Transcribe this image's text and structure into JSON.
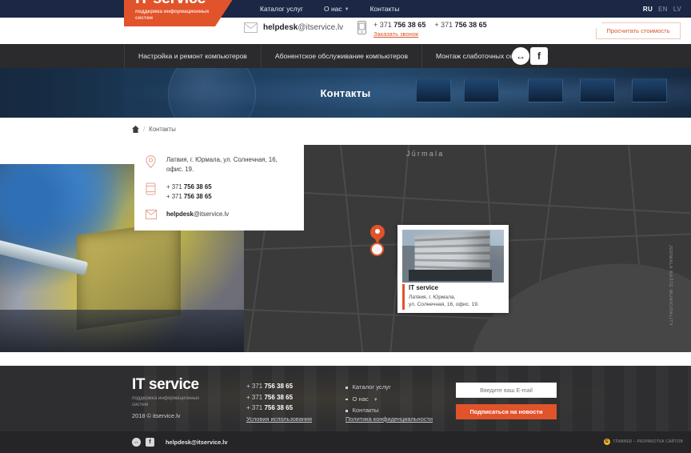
{
  "topbar": {
    "nav": [
      {
        "label": "Каталог услуг",
        "has_caret": false
      },
      {
        "label": "О нас",
        "has_caret": true
      },
      {
        "label": "Контакты",
        "has_caret": false
      }
    ],
    "languages": [
      {
        "code": "RU",
        "active": true
      },
      {
        "code": "EN",
        "active": false
      },
      {
        "code": "LV",
        "active": false
      }
    ]
  },
  "header": {
    "logo": {
      "main": "IT service",
      "sub": "поддержка информационных систем"
    },
    "email": {
      "user": "helpdesk",
      "domain": "@itservice.lv",
      "icon": "envelope-icon"
    },
    "phones": [
      "+ 371 756 38 65",
      "+ 371 756 38 65"
    ],
    "phone_prefix": "+ 371 ",
    "phone_number": "756 38 65",
    "callback_label": "Заказать звонок",
    "calc_button": "Просчитать стоимость"
  },
  "subnav": {
    "items": [
      "Настройка и ремонт компьютеров",
      "Абонентское обслуживание компьютеров",
      "Монтаж слаботочных сетей"
    ],
    "social": [
      {
        "name": "odnoklassniki-icon",
        "glyph": "↔"
      },
      {
        "name": "facebook-icon",
        "glyph": "f"
      }
    ]
  },
  "hero": {
    "title": "Контакты"
  },
  "breadcrumb": {
    "home_icon": "home-icon",
    "separator": "/",
    "current": "Контакты"
  },
  "contact_card": {
    "address_icon": "map-pin-icon",
    "address": "Латвия, г. Юрмала, ул. Солнечная, 16, офис. 19.",
    "phone_icon": "phone-icon",
    "phones": [
      {
        "prefix": "+ 371 ",
        "number": "756 38 65"
      },
      {
        "prefix": "+ 371 ",
        "number": "756 38 65"
      }
    ],
    "email_icon": "envelope-icon",
    "email_user": "helpdesk",
    "email_domain": "@itservice.lv"
  },
  "map": {
    "city_label": "Jūrmala",
    "side_label": "JŪRMALA BAŠTE MUNICIPALITY",
    "marker": "map-marker-icon",
    "popup": {
      "title": "IT service",
      "address_line1": "Латвия, г. Юрмала,",
      "address_line2": "ул. Солнечная, 16, офис. 19."
    }
  },
  "footer": {
    "logo": {
      "main": "IT service",
      "sub": "поддержка информационных систем"
    },
    "copyright": "2018 © itservice.lv",
    "phones": [
      {
        "prefix": "+ 371 ",
        "number": "756 38 65"
      },
      {
        "prefix": "+ 371 ",
        "number": "756 38 65"
      },
      {
        "prefix": "+ 371 ",
        "number": "756 38 65"
      }
    ],
    "terms_link": "Условия использования",
    "menu": [
      {
        "label": "Каталог услуг",
        "has_caret": false
      },
      {
        "label": "О нас",
        "has_caret": true
      },
      {
        "label": "Контакты",
        "has_caret": false
      }
    ],
    "privacy_link": "Политика конфиденциальности",
    "subscribe": {
      "placeholder": "Введите ваш E-mail",
      "value": "",
      "button_label": "Подписаться на новости"
    },
    "bottom": {
      "social": [
        {
          "name": "odnoklassniki-icon",
          "glyph": "↔"
        },
        {
          "name": "facebook-icon",
          "glyph": "f"
        }
      ],
      "email": "helpdesk@itservice.lv",
      "credit": "ГЛАВВЕБ – РАЗРАБОТКА САЙТОВ",
      "credit_mark": "G"
    }
  },
  "colors": {
    "brand_orange": "#e1532a",
    "topbar_navy": "#1b2744",
    "subnav_dark": "#2b2b2d",
    "footer_dark": "#2e2e30"
  }
}
